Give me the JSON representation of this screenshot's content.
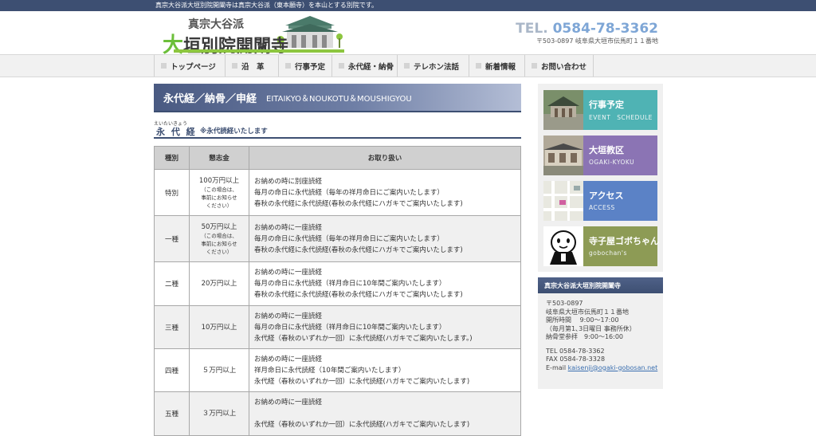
{
  "topbar": {
    "text": "真宗大谷派大垣別院開闡寺は真宗大谷派（東本願寺）を本山とする別院です。"
  },
  "logo": {
    "small": "真宗大谷派",
    "big_first": "大",
    "big_rest": "垣別院開闡寺"
  },
  "contact": {
    "tel_prefix": "TEL.",
    "tel": "0584-78-3362",
    "address": "〒503-0897 岐阜県大垣市伝馬町１１番地"
  },
  "nav": [
    {
      "label": "トップページ"
    },
    {
      "label": "沿　革"
    },
    {
      "label": "行事予定"
    },
    {
      "label": "永代経・納骨"
    },
    {
      "label": "テレホン法話"
    },
    {
      "label": "新着情報"
    },
    {
      "label": "お問い合わせ"
    }
  ],
  "page": {
    "title_jp": "永代経／納骨／申経",
    "title_en": "EITAIKYO＆NOUKOTU＆MOUSHIGYOU"
  },
  "section": {
    "ruby": "えいたいきょう",
    "title": "永 代 経",
    "note": "※永代読経いたします"
  },
  "table": {
    "headers": [
      "種別",
      "懇志金",
      "お取り扱い"
    ],
    "rows": [
      {
        "kind": "特別",
        "amount": "100万円以上",
        "note": [
          "（この場合は、",
          "事前にお知らせ",
          "ください）"
        ],
        "lines": [
          "お納めの時に別座読経",
          "毎月の命日に永代読経（毎年の祥月命日にご案内いたします）",
          "春秋の永代経に永代読経(春秋の永代経にハガキでご案内いたします)"
        ]
      },
      {
        "kind": "一種",
        "amount": "50万円以上",
        "note": [
          "（この場合は、",
          "事前にお知らせ",
          "ください）"
        ],
        "lines": [
          "お納めの時に一座読経",
          "毎月の命日に永代読経（毎年の祥月命日にご案内いたします）",
          "春秋の永代経に永代読経(春秋の永代経にハガキでご案内いたします)"
        ]
      },
      {
        "kind": "二種",
        "amount": "20万円以上",
        "lines": [
          "お納めの時に一座読経",
          "毎月の命日に永代読経（祥月命日に10年間ご案内いたします）",
          "春秋の永代経に永代読経(春秋の永代経にハガキでご案内いたします)"
        ]
      },
      {
        "kind": "三種",
        "amount": "10万円以上",
        "lines": [
          "お納めの時に一座読経",
          "毎月の命日に永代読経（祥月命日に10年間ご案内いたします）",
          "永代経（春秋のいずれか一回）に永代読経(ハガキでご案内いたします。)"
        ]
      },
      {
        "kind": "四種",
        "amount": "５万円以上",
        "lines": [
          "お納めの時に一座読経",
          "祥月命日に永代読経（10年間ご案内いたします）",
          "永代経（春秋のいずれか一回）に永代読経(ハガキでご案内いたします)"
        ]
      },
      {
        "kind": "五種",
        "amount": "３万円以上",
        "lines": [
          "お納めの時に一座読経",
          "",
          "永代経（春秋のいずれか一回）に永代読経(ハガキでご案内いたします)"
        ]
      }
    ]
  },
  "banners": [
    {
      "title": "行事予定",
      "sub": "EVENT　SCHEDULE",
      "color": "#4fb3b4"
    },
    {
      "title": "大垣教区",
      "sub": "OGAKI-KYOKU",
      "color": "#8b74b4"
    },
    {
      "title": "アクセス",
      "sub": "ACCESS",
      "color": "#5b82c6"
    },
    {
      "title": "寺子屋ゴボちゃん",
      "sub": "gobochan's",
      "color": "#8d9b55"
    }
  ],
  "info": {
    "title": "真宗大谷派大垣別院開闡寺",
    "postal": "〒503-0897",
    "address": "岐阜県大垣市伝馬町１１番地",
    "hours": "開所時間　 9:00〜17:00",
    "closed": "（毎月第1､3日曜日 事務所休）",
    "worship": "納骨堂参拝　9:00〜16:00",
    "tel": "TEL 0584-78-3362",
    "fax": "FAX 0584-78-3328",
    "email_label": "E-mail ",
    "email": "kaisenji@ogaki-gobosan.net"
  }
}
